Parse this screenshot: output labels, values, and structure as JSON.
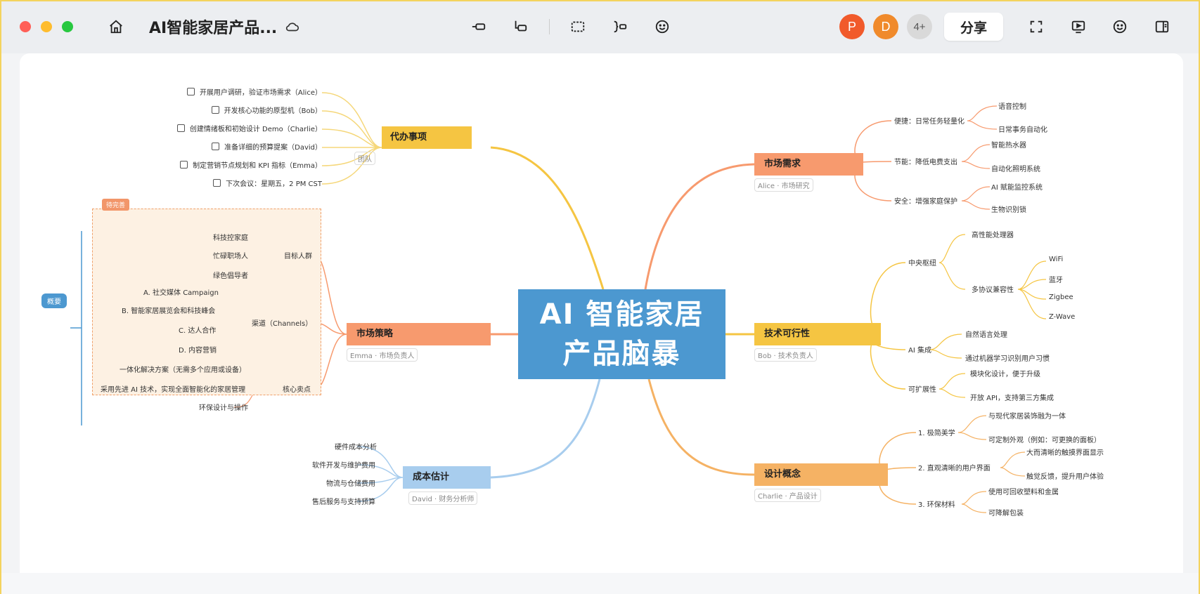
{
  "app": {
    "doc_title": "AI智能家居产品...",
    "share_label": "分享",
    "avatars": [
      {
        "letter": "P",
        "color": "#f15a2b"
      },
      {
        "letter": "D",
        "color": "#f08a2b"
      },
      {
        "letter": "4+",
        "color": "#d9d9d9"
      }
    ]
  },
  "colors": {
    "accent_blue": "#4c98d0",
    "yellow": "#f5c542",
    "orange": "#f79a6e",
    "light_orange": "#f5b264",
    "light_blue": "#a8cdee"
  },
  "mindmap": {
    "center": {
      "line1": "AI 智能家居",
      "line2": "产品脑暴"
    },
    "todo": {
      "title": "代办事项",
      "subtitle": "团队",
      "items": [
        "开展用户调研，验证市场需求（Alice）",
        "开发核心功能的原型机（Bob）",
        "创建情绪板和初始设计 Demo（Charlie）",
        "准备详细的预算提案（David）",
        "制定营销节点规划和 KPI 指标（Emma）",
        "下次会议：星期五，2 PM CST"
      ]
    },
    "strategy": {
      "title": "市场策略",
      "subtitle": "Emma · 市场负责人",
      "tag": "待完善",
      "summary": "概要",
      "groups": [
        {
          "label": "目标人群",
          "items": [
            "科技控家庭",
            "忙碌职场人",
            "绿色倡导者"
          ]
        },
        {
          "label": "渠道（Channels）",
          "items": [
            "A. 社交媒体 Campaign",
            "B. 智能家居展览会和科技峰会",
            "C. 达人合作",
            "D. 内容营销"
          ]
        },
        {
          "label": "核心卖点",
          "items": [
            "一体化解决方案（无需多个应用或设备）",
            "采用先进 AI 技术，实现全面智能化的家居管理",
            "环保设计与操作"
          ]
        }
      ]
    },
    "cost": {
      "title": "成本估计",
      "subtitle": "David · 财务分析师",
      "items": [
        "硬件成本分析",
        "软件开发与维护费用",
        "物流与仓储费用",
        "售后服务与支持预算"
      ]
    },
    "market": {
      "title": "市场需求",
      "subtitle": "Alice · 市场研究",
      "groups": [
        {
          "label": "便捷：日常任务轻量化",
          "items": [
            "语音控制",
            "日常事务自动化"
          ]
        },
        {
          "label": "节能：降低电费支出",
          "items": [
            "智能热水器",
            "自动化照明系统"
          ]
        },
        {
          "label": "安全：增强家庭保护",
          "items": [
            "AI 赋能监控系统",
            "生物识别锁"
          ]
        }
      ]
    },
    "tech": {
      "title": "技术可行性",
      "subtitle": "Bob · 技术负责人",
      "groups": [
        {
          "label": "中央枢纽",
          "items": [
            "高性能处理器",
            "多协议兼容性"
          ],
          "protocols": [
            "WiFi",
            "蓝牙",
            "Zigbee",
            "Z-Wave"
          ]
        },
        {
          "label": "AI 集成",
          "items": [
            "自然语言处理",
            "通过机器学习识别用户习惯"
          ]
        },
        {
          "label": "可扩展性",
          "items": [
            "模块化设计，便于升级",
            "开放 API，支持第三方集成"
          ]
        }
      ]
    },
    "design": {
      "title": "设计概念",
      "subtitle": "Charlie · 产品设计",
      "groups": [
        {
          "label": "1. 极简美学",
          "items": [
            "与现代家居装饰融为一体",
            "可定制外观（例如：可更换的面板）"
          ]
        },
        {
          "label": "2. 直观清晰的用户界面",
          "items": [
            "大而清晰的触摸界面显示",
            "触觉反馈，提升用户体验"
          ]
        },
        {
          "label": "3. 环保材料",
          "items": [
            "使用可回收塑料和金属",
            "可降解包装"
          ]
        }
      ]
    }
  }
}
